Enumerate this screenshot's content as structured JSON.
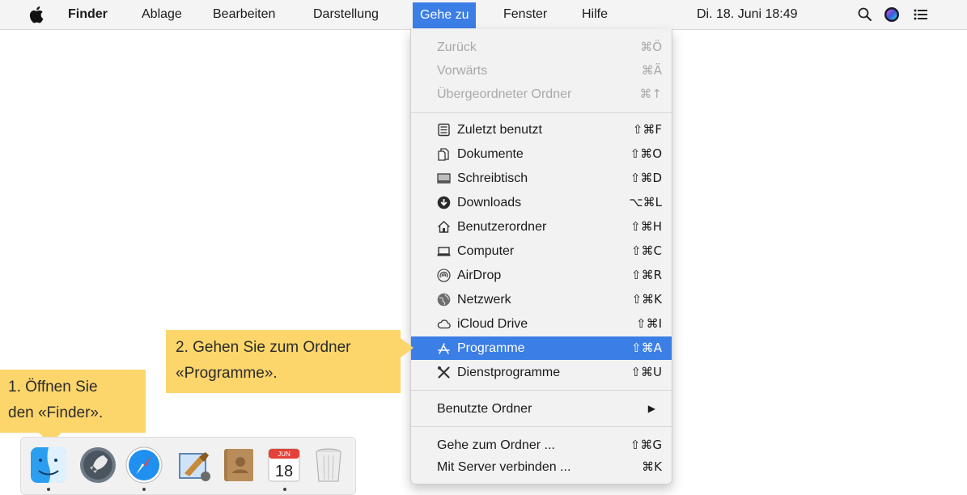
{
  "menubar": {
    "app_name": "Finder",
    "items": [
      "Ablage",
      "Bearbeiten",
      "Darstellung",
      "Gehe zu",
      "Fenster",
      "Hilfe"
    ],
    "clock": "Di. 18. Juni 18:49",
    "status_icons": [
      "search-icon",
      "siri-icon",
      "notification-center-icon"
    ]
  },
  "go_menu": {
    "nav": [
      {
        "label": "Zurück",
        "shortcut": "⌘Ö",
        "enabled": false
      },
      {
        "label": "Vorwärts",
        "shortcut": "⌘Ä",
        "enabled": false
      },
      {
        "label": "Übergeordneter Ordner",
        "shortcut": "⌘↑",
        "enabled": false
      }
    ],
    "places": [
      {
        "label": "Zuletzt benutzt",
        "shortcut": "⇧⌘F",
        "icon": "recents-icon"
      },
      {
        "label": "Dokumente",
        "shortcut": "⇧⌘O",
        "icon": "documents-icon"
      },
      {
        "label": "Schreibtisch",
        "shortcut": "⇧⌘D",
        "icon": "desktop-icon"
      },
      {
        "label": "Downloads",
        "shortcut": "⌥⌘L",
        "icon": "downloads-icon"
      },
      {
        "label": "Benutzerordner",
        "shortcut": "⇧⌘H",
        "icon": "home-icon"
      },
      {
        "label": "Computer",
        "shortcut": "⇧⌘C",
        "icon": "computer-icon"
      },
      {
        "label": "AirDrop",
        "shortcut": "⇧⌘R",
        "icon": "airdrop-icon"
      },
      {
        "label": "Netzwerk",
        "shortcut": "⇧⌘K",
        "icon": "network-icon"
      },
      {
        "label": "iCloud Drive",
        "shortcut": "⇧⌘I",
        "icon": "icloud-icon"
      },
      {
        "label": "Programme",
        "shortcut": "⇧⌘A",
        "icon": "applications-icon",
        "highlighted": true
      },
      {
        "label": "Dienstprogramme",
        "shortcut": "⇧⌘U",
        "icon": "utilities-icon"
      }
    ],
    "recent_folders": {
      "label": "Benutzte Ordner",
      "arrow": "▶"
    },
    "go_to_folder": {
      "label": "Gehe zum Ordner ...",
      "shortcut": "⇧⌘G"
    },
    "connect_server": {
      "label": "Mit Server verbinden ...",
      "shortcut": "⌘K"
    }
  },
  "callouts": {
    "step1_line1": "1. Öffnen Sie",
    "step1_line2": "den «Finder».",
    "step2_line1": "2. Gehen Sie zum Ordner",
    "step2_line2": "«Programme»."
  },
  "calendar_day": "18",
  "calendar_month": "JUN",
  "colors": {
    "highlight": "#3b7ee6",
    "callout": "#fcd56b",
    "disabled_text": "#a9a9a9"
  },
  "dock": [
    "finder-icon",
    "launchpad-icon",
    "safari-icon",
    "mail-icon",
    "contacts-icon",
    "calendar-icon",
    "trash-icon"
  ]
}
